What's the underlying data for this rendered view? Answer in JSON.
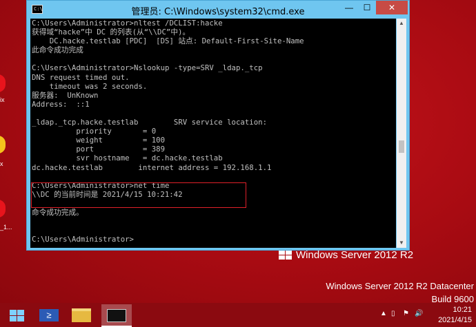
{
  "desktop": {
    "labels": [
      "ix",
      "x",
      "_1..."
    ]
  },
  "window": {
    "title": "管理员: C:\\Windows\\system32\\cmd.exe",
    "icon_text": "C:\\",
    "buttons": {
      "minimize": "—",
      "maximize": "☐",
      "close": "✕"
    }
  },
  "console": {
    "text": "C:\\Users\\Administrator>nltest /DCLIST:hacke\n获得域“hacke”中 DC 的列表(从“\\\\DC”中)。\n    DC.hacke.testlab [PDC]  [DS] 站点: Default-First-Site-Name\n此命令成功完成\n\nC:\\Users\\Administrator>Nslookup -type=SRV _ldap._tcp\nDNS request timed out.\n    timeout was 2 seconds.\n服务器:  UnKnown\nAddress:  ::1\n\n_ldap._tcp.hacke.testlab        SRV service location:\n          priority       = 0\n          weight         = 100\n          port           = 389\n          svr hostname   = dc.hacke.testlab\ndc.hacke.testlab        internet address = 192.168.1.1\n\nC:\\Users\\Administrator>net time\n\\\\DC 的当前时间是 2021/4/15 10:21:42\n\n命令成功完成。\n\n\nC:\\Users\\Administrator>"
  },
  "branding": {
    "logo_text": "Windows Server 2012 R2",
    "edition": "Windows Server 2012 R2 Datacenter",
    "build": "Build 9600"
  },
  "taskbar": {
    "powershell_glyph": "≥",
    "tray_icons": [
      "▲",
      "▯",
      "⚑",
      "🔊"
    ],
    "time": "10:21",
    "date": "2021/4/15"
  },
  "colors": {
    "desktop": "#b30b12",
    "window_frame": "#6fc6f0",
    "console_bg": "#000000",
    "console_fg": "#c0c0c0",
    "highlight": "#e0202a"
  }
}
